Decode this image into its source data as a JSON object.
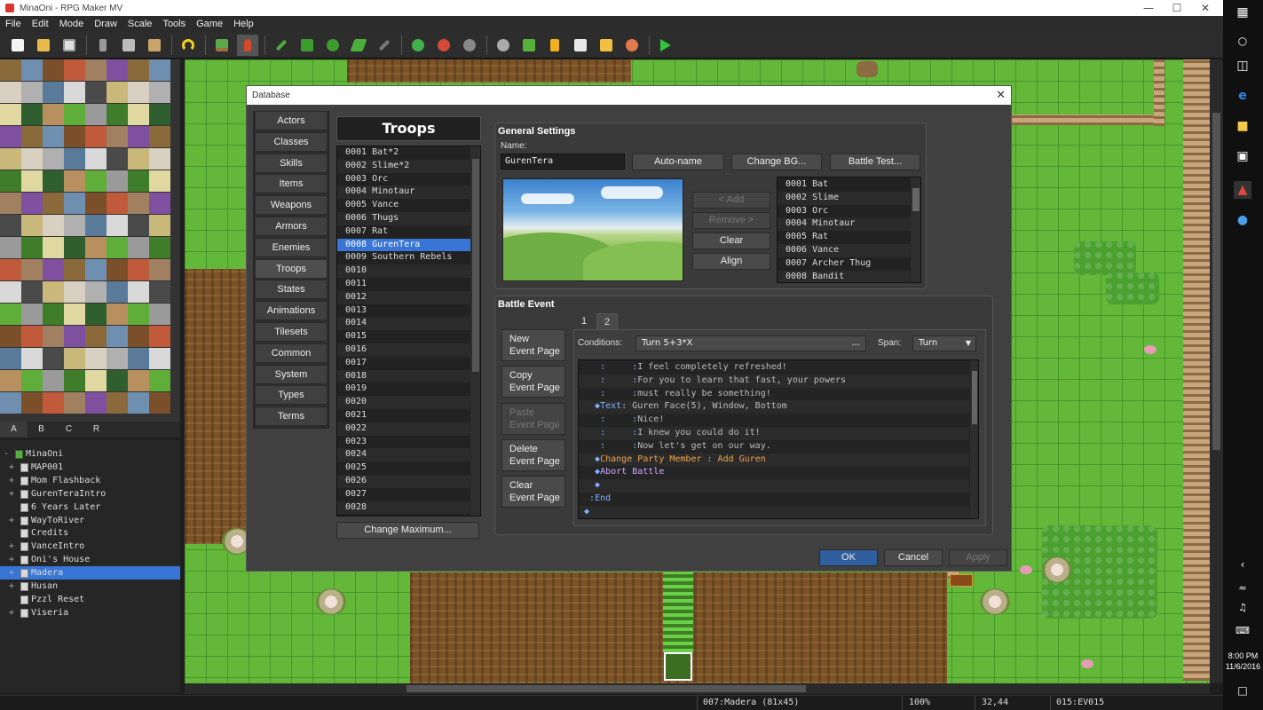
{
  "window": {
    "title": "MinaOni - RPG Maker MV"
  },
  "menu": [
    "File",
    "Edit",
    "Mode",
    "Draw",
    "Scale",
    "Tools",
    "Game",
    "Help"
  ],
  "toolbar": {
    "icons": [
      "new-project-icon",
      "open-project-icon",
      "save-project-icon",
      "cut-icon",
      "copy-icon",
      "paste-icon",
      "undo-icon",
      "map-mode-icon",
      "event-mode-icon",
      "pencil-icon",
      "rectangle-icon",
      "ellipse-icon",
      "fill-icon",
      "shadow-pen-icon",
      "zoom-in-icon",
      "zoom-out-icon",
      "actual-size-icon",
      "database-icon",
      "plugin-manager-icon",
      "sound-test-icon",
      "event-searcher-icon",
      "resource-manager-icon",
      "character-generator-icon",
      "playtest-icon"
    ]
  },
  "tileset_tabs": [
    "A",
    "B",
    "C",
    "R"
  ],
  "map_tree": [
    {
      "label": "MinaOni",
      "expander": "-",
      "root": true,
      "indent": 0
    },
    {
      "label": "MAP001",
      "expander": "+",
      "indent": 1
    },
    {
      "label": "Mom Flashback",
      "expander": "+",
      "indent": 1
    },
    {
      "label": "GurenTeraIntro",
      "expander": "+",
      "indent": 1
    },
    {
      "label": "6 Years Later",
      "expander": "",
      "indent": 1
    },
    {
      "label": "WayToRiver",
      "expander": "+",
      "indent": 1
    },
    {
      "label": "Credits",
      "expander": "",
      "indent": 1
    },
    {
      "label": "VanceIntro",
      "expander": "+",
      "indent": 1
    },
    {
      "label": "Oni's House",
      "expander": "+",
      "indent": 1
    },
    {
      "label": "Madera",
      "expander": "+",
      "indent": 1,
      "selected": true
    },
    {
      "label": "Husan",
      "expander": "+",
      "indent": 1
    },
    {
      "label": "Pzzl Reset",
      "expander": "",
      "indent": 1
    },
    {
      "label": "Viseria",
      "expander": "+",
      "indent": 1
    }
  ],
  "status": {
    "map": "007:Madera (81x45)",
    "zoom": "100%",
    "coords": "32,44",
    "event": "015:EV015"
  },
  "clock": {
    "time": "8:00 PM",
    "date": "11/6/2016"
  },
  "dialog": {
    "title": "Database",
    "nav": [
      "Actors",
      "Classes",
      "Skills",
      "Items",
      "Weapons",
      "Armors",
      "Enemies",
      "Troops",
      "States",
      "Animations",
      "Tilesets",
      "Common Events",
      "System",
      "Types",
      "Terms"
    ],
    "nav_selected": "Troops",
    "header": "Troops",
    "troops": [
      "0001 Bat*2",
      "0002 Slime*2",
      "0003 Orc",
      "0004 Minotaur",
      "0005 Vance",
      "0006 Thugs",
      "0007 Rat",
      "0008 GurenTera",
      "0009 Southern Rebels",
      "0010",
      "0011",
      "0012",
      "0013",
      "0014",
      "0015",
      "0016",
      "0017",
      "0018",
      "0019",
      "0020",
      "0021",
      "0022",
      "0023",
      "0024",
      "0025",
      "0026",
      "0027",
      "0028"
    ],
    "troop_selected_index": 7,
    "change_max": "Change Maximum...",
    "general": {
      "title": "General Settings",
      "name_label": "Name:",
      "name_value": "GurenTera",
      "autoname": "Auto-name",
      "change_bg": "Change BG...",
      "battle_test": "Battle Test...",
      "add": "< Add",
      "remove": "Remove >",
      "clear": "Clear",
      "align": "Align",
      "enemies": [
        "0001 Bat",
        "0002 Slime",
        "0003 Orc",
        "0004 Minotaur",
        "0005 Rat",
        "0006 Vance",
        "0007 Archer Thug",
        "0008 Bandit"
      ]
    },
    "battle_event": {
      "title": "Battle Event",
      "tabs": [
        "1",
        "2"
      ],
      "active_tab": "2",
      "conditions_label": "Conditions:",
      "conditions_value": "Turn 5+3*X",
      "conditions_more": "...",
      "span_label": "Span:",
      "span_value": "Turn",
      "pages": {
        "new": [
          "New",
          "Event Page"
        ],
        "copy": [
          "Copy",
          "Event Page"
        ],
        "paste": [
          "Paste",
          "Event Page"
        ],
        "delete": [
          "Delete",
          "Event Page"
        ],
        "clear": [
          "Clear",
          "Event Page"
        ]
      },
      "commands": [
        {
          "prefix": "    :     :",
          "text": "I feel completely refreshed!",
          "color": "grey"
        },
        {
          "prefix": "    :     :",
          "text": "For you to learn that fast, your powers",
          "color": "grey"
        },
        {
          "prefix": "    :     :",
          "text": "must really be something!",
          "color": "grey"
        },
        {
          "prefix": "   ◆Text",
          "text": ": Guren Face(5), Window, Bottom",
          "color": "grey"
        },
        {
          "prefix": "    :     :",
          "text": "Nice!",
          "color": "grey"
        },
        {
          "prefix": "    :     :",
          "text": "I knew you could do it!",
          "color": "grey"
        },
        {
          "prefix": "    :     :",
          "text": "Now let's get on our way.",
          "color": "grey"
        },
        {
          "prefix": "   ◆",
          "text": "Change Party Member : Add Guren",
          "color": "orange"
        },
        {
          "prefix": "   ◆",
          "text": "Abort Battle",
          "color": "purple"
        },
        {
          "prefix": "   ◆",
          "text": "",
          "color": "grey"
        },
        {
          "prefix": "  :",
          "text": "End",
          "color": "blue"
        },
        {
          "prefix": " ◆",
          "text": "",
          "color": "grey"
        }
      ]
    },
    "ok": "OK",
    "cancel": "Cancel",
    "apply": "Apply"
  }
}
